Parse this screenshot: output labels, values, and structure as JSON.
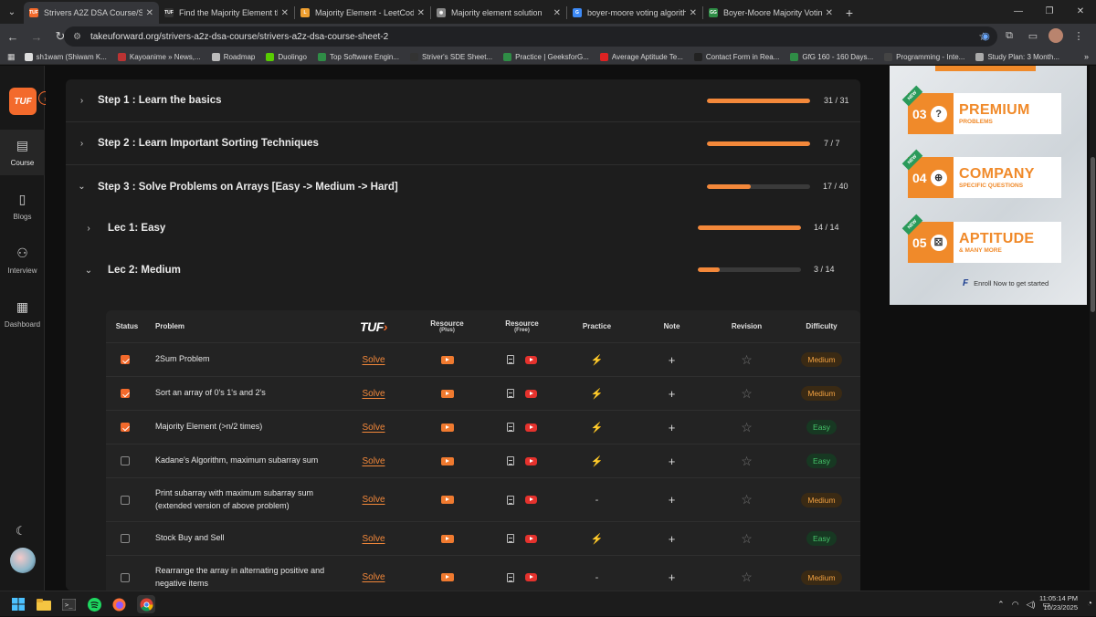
{
  "browser": {
    "tabs": [
      {
        "title": "Strivers A2Z DSA Course/Sheet",
        "active": true,
        "fav_color": "#f36a2c",
        "fav_glyph": "TUF"
      },
      {
        "title": "Find the Majority Element that",
        "active": false,
        "fav_color": "#333",
        "fav_glyph": "TUF"
      },
      {
        "title": "Majority Element - LeetCode",
        "active": false,
        "fav_color": "#f0a030",
        "fav_glyph": "L"
      },
      {
        "title": "Majority element solution",
        "active": false,
        "fav_color": "#888",
        "fav_glyph": "◉"
      },
      {
        "title": "boyer-moore voting algorithm",
        "active": false,
        "fav_color": "#3d8af7",
        "fav_glyph": "G"
      },
      {
        "title": "Boyer-Moore Majority Voting A",
        "active": false,
        "fav_color": "#2f8d46",
        "fav_glyph": "GG"
      }
    ],
    "url": "takeuforward.org/strivers-a2z-dsa-course/strivers-a2z-dsa-course-sheet-2",
    "bookmarks": [
      {
        "label": "sh1wam (Shiwam K...",
        "color": "#ddd"
      },
      {
        "label": "Kayoanime » News,...",
        "color": "#b33"
      },
      {
        "label": "Roadmap",
        "color": "#bbb"
      },
      {
        "label": "Duolingo",
        "color": "#58cc02"
      },
      {
        "label": "Top Software Engin...",
        "color": "#2f8d46"
      },
      {
        "label": "Striver's SDE Sheet...",
        "color": "#333"
      },
      {
        "label": "Practice | GeeksforG...",
        "color": "#2f8d46"
      },
      {
        "label": "Average Aptitude Te...",
        "color": "#d22"
      },
      {
        "label": "Contact Form in Rea...",
        "color": "#222"
      },
      {
        "label": "GfG 160 - 160 Days...",
        "color": "#2f8d46"
      },
      {
        "label": "Programming - Inte...",
        "color": "#444"
      },
      {
        "label": "Study Plan: 3 Month...",
        "color": "#aaa"
      }
    ],
    "bookmarks_more": "»"
  },
  "sidebar": {
    "logo": "TUF",
    "items": [
      {
        "label": "Course",
        "icon": "course-icon",
        "glyph": "▤"
      },
      {
        "label": "Blogs",
        "icon": "blogs-icon",
        "glyph": "▯"
      },
      {
        "label": "Interview",
        "icon": "interview-icon",
        "glyph": "⚇"
      },
      {
        "label": "Dashboard",
        "icon": "dashboard-icon",
        "glyph": "▦"
      }
    ]
  },
  "steps": [
    {
      "title": "Step 1 : Learn the basics",
      "count": "31 / 31",
      "progress": 1.0
    },
    {
      "title": "Step 2 : Learn Important Sorting Techniques",
      "count": "7 / 7",
      "progress": 1.0
    },
    {
      "title": "Step 3 : Solve Problems on Arrays [Easy -> Medium -> Hard]",
      "count": "17 / 40",
      "progress": 0.425
    }
  ],
  "lectures": [
    {
      "title": "Lec 1: Easy",
      "count": "14 / 14",
      "progress": 1.0
    },
    {
      "title": "Lec 2: Medium",
      "count": "3 / 14",
      "progress": 0.214
    }
  ],
  "table": {
    "headers": {
      "status": "Status",
      "problem": "Problem",
      "tuf": "TUF",
      "resource_plus": "Resource",
      "resource_plus_sub": "(Plus)",
      "resource_free": "Resource",
      "resource_free_sub": "(Free)",
      "practice": "Practice",
      "note": "Note",
      "revision": "Revision",
      "difficulty": "Difficulty"
    },
    "solve_label": "Solve",
    "rows": [
      {
        "done": true,
        "problem": "2Sum Problem",
        "practice": "link",
        "difficulty": "Medium"
      },
      {
        "done": true,
        "problem": "Sort an array of 0's 1's and 2's",
        "practice": "link",
        "difficulty": "Medium"
      },
      {
        "done": true,
        "problem": "Majority Element (>n/2 times)",
        "practice": "link",
        "difficulty": "Easy"
      },
      {
        "done": false,
        "problem": "Kadane's Algorithm, maximum subarray sum",
        "practice": "link",
        "difficulty": "Easy"
      },
      {
        "done": false,
        "problem": "Print subarray with maximum subarray sum (extended version of above problem)",
        "practice": "-",
        "difficulty": "Medium"
      },
      {
        "done": false,
        "problem": "Stock Buy and Sell",
        "practice": "link",
        "difficulty": "Easy"
      },
      {
        "done": false,
        "problem": "Rearrange the array in alternating positive and negative items",
        "practice": "-",
        "difficulty": "Medium"
      }
    ]
  },
  "ad": {
    "cards": [
      {
        "num": "03",
        "big": "PREMIUM",
        "small": "PROBLEMS",
        "badge": "NEW",
        "glyph": "?"
      },
      {
        "num": "04",
        "big": "COMPANY",
        "small": "SPECIFIC QUESTIONS",
        "badge": "NEW",
        "glyph": "⊕"
      },
      {
        "num": "05",
        "big": "APTITUDE",
        "small": "& MANY MORE",
        "badge": "NEW",
        "glyph": "⚄"
      }
    ],
    "footer": "Enroll Now to get started",
    "footer_logo": "F"
  },
  "taskbar": {
    "time": "11:05:14 PM",
    "date": "10/23/2025"
  }
}
